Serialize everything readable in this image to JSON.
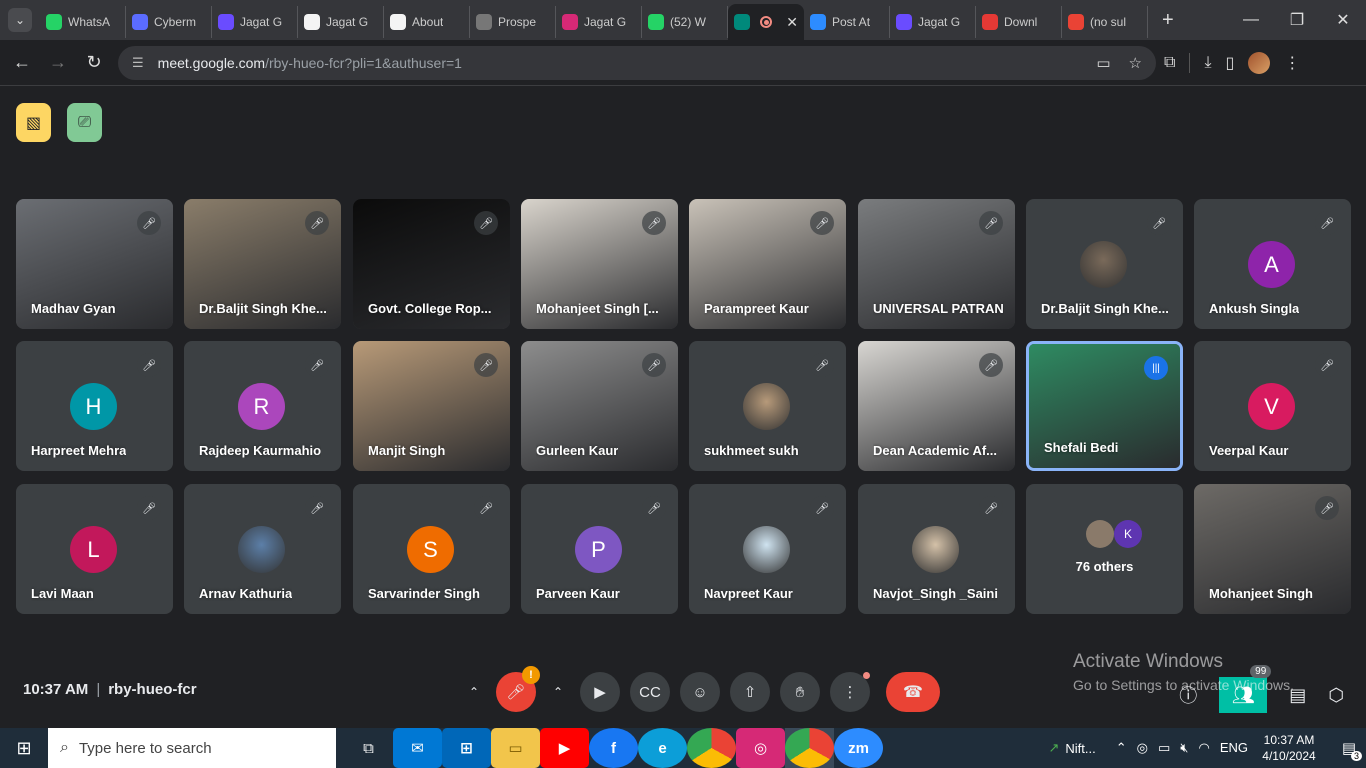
{
  "browser": {
    "tabs": [
      {
        "label": "WhatsA",
        "favicon_color": "#25d366",
        "icon": "whatsapp-icon"
      },
      {
        "label": "Cyberm",
        "favicon_color": "#5b6cff",
        "icon": "cyber-icon"
      },
      {
        "label": "Jagat G",
        "favicon_color": "#6a4cff",
        "icon": "canva-icon"
      },
      {
        "label": "Jagat G",
        "favicon_color": "#f4f4f4",
        "icon": "college-icon"
      },
      {
        "label": "About",
        "favicon_color": "#f4f4f4",
        "icon": "college-icon"
      },
      {
        "label": "Prospe",
        "favicon_color": "#777777",
        "icon": "globe-icon"
      },
      {
        "label": "Jagat G",
        "favicon_color": "#d62976",
        "icon": "instagram-icon"
      },
      {
        "label": "(52) W",
        "favicon_color": "#25d366",
        "icon": "whatsapp-icon"
      },
      {
        "label": "",
        "favicon_color": "#00897b",
        "icon": "meet-icon",
        "active": true
      },
      {
        "label": "Post At",
        "favicon_color": "#2d8cff",
        "icon": "zoom-icon"
      },
      {
        "label": "Jagat G",
        "favicon_color": "#6a4cff",
        "icon": "canva-icon"
      },
      {
        "label": "Downl",
        "favicon_color": "#e53935",
        "icon": "heart-icon"
      },
      {
        "label": "(no sul",
        "favicon_color": "#ea4335",
        "icon": "gmail-icon"
      }
    ],
    "url_host": "meet.google.com",
    "url_path": "/rby-hueo-fcr?pli=1&authuser=1"
  },
  "participants": [
    {
      "name": "Madhav Gyan",
      "type": "video",
      "bg": "#6b6e73"
    },
    {
      "name": "Dr.Baljit Singh Khe...",
      "type": "video",
      "bg": "#8a7d6a"
    },
    {
      "name": "Govt. College Rop...",
      "type": "video",
      "bg": "#0b0b0b"
    },
    {
      "name": "Mohanjeet Singh [...",
      "type": "video",
      "bg": "#d9d4cc"
    },
    {
      "name": "Parampreet Kaur",
      "type": "video",
      "bg": "#c9c2b8"
    },
    {
      "name": "UNIVERSAL PATRAN",
      "type": "video",
      "bg": "#7a7c7e"
    },
    {
      "name": "Dr.Baljit Singh Khe...",
      "type": "photo",
      "bg": "#3c4043",
      "photo": "#7a6a5a"
    },
    {
      "name": "Ankush Singla",
      "type": "initial",
      "initial": "A",
      "color": "#8e24aa"
    },
    {
      "name": "Harpreet Mehra",
      "type": "initial",
      "initial": "H",
      "color": "#0097a7"
    },
    {
      "name": "Rajdeep Kaurmahio",
      "type": "initial",
      "initial": "R",
      "color": "#ab47bc"
    },
    {
      "name": "Manjit Singh",
      "type": "video",
      "bg": "#b89a78"
    },
    {
      "name": "Gurleen Kaur",
      "type": "video",
      "bg": "#8d8d8d"
    },
    {
      "name": "sukhmeet sukh",
      "type": "photo",
      "bg": "#3c4043",
      "photo": "#b79a7a"
    },
    {
      "name": "Dean Academic Af...",
      "type": "video",
      "bg": "#d8d6d2"
    },
    {
      "name": "Shefali Bedi",
      "type": "video",
      "bg": "#2e8b62",
      "speaking": true
    },
    {
      "name": "Veerpal Kaur",
      "type": "initial",
      "initial": "V",
      "color": "#d81b60"
    },
    {
      "name": "Lavi Maan",
      "type": "initial",
      "initial": "L",
      "color": "#c2185b"
    },
    {
      "name": "Arnav Kathuria",
      "type": "photo",
      "bg": "#3c4043",
      "photo": "#5c7fa8"
    },
    {
      "name": "Sarvarinder Singh",
      "type": "initial",
      "initial": "S",
      "color": "#ef6c00"
    },
    {
      "name": "Parveen Kaur",
      "type": "initial",
      "initial": "P",
      "color": "#7e57c2"
    },
    {
      "name": "Navpreet Kaur",
      "type": "photo",
      "bg": "#3c4043",
      "photo": "#cfe3f0"
    },
    {
      "name": "Navjot_Singh _Saini",
      "type": "photo",
      "bg": "#3c4043",
      "photo": "#d4c1a8"
    },
    {
      "name": "76 others",
      "type": "others"
    },
    {
      "name": "Mohanjeet Singh",
      "type": "video",
      "bg": "#6d6a66"
    }
  ],
  "others_avatars": [
    {
      "initial": "",
      "color": "#8a7a6a"
    },
    {
      "initial": "K",
      "color": "#5e35b1"
    }
  ],
  "meeting": {
    "time": "10:37 AM",
    "code": "rby-hueo-fcr",
    "mic_warning": "!",
    "people_count": "99"
  },
  "windows_notice": {
    "line1": "Activate Windows",
    "line2": "Go to Settings to activate Windows."
  },
  "taskbar": {
    "search_placeholder": "Type here to search",
    "nifty_label": "Nift...",
    "language": "ENG",
    "clock_time": "10:37 AM",
    "clock_date": "4/10/2024",
    "notification_count": "3"
  }
}
